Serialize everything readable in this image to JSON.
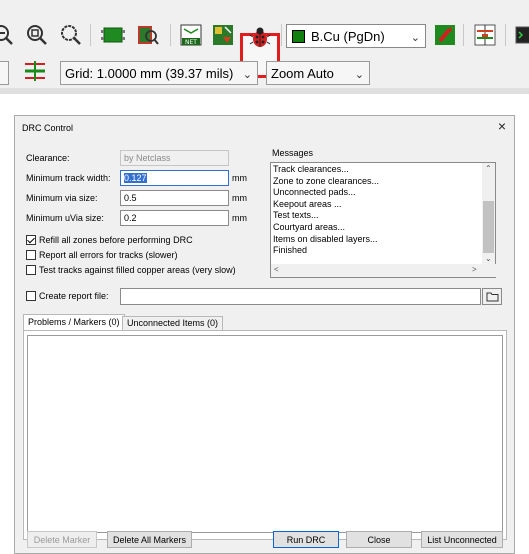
{
  "toolbar": {
    "icons": [
      "zoom-out-icon",
      "zoom-fit-icon",
      "zoom-selection-icon",
      "footprint-editor-icon",
      "footprint-browser-icon",
      "netlist-icon",
      "update-pcb-icon",
      "drc-ladybug-icon",
      "layer-pair-icon",
      "microwave-icon",
      "scripting-icon"
    ],
    "layer_select": "B.Cu (PgDn)",
    "layer_color": "#108010",
    "grid_select": "Grid: 1.0000 mm (39.37 mils)",
    "zoom_select": "Zoom Auto",
    "highlight_color": "#e21d1d"
  },
  "dialog": {
    "title": "DRC Control",
    "close": "×",
    "clearance_label": "Clearance:",
    "clearance_value": "by Netclass",
    "min_track_label": "Minimum track width:",
    "min_track_value": "0.127",
    "min_track_unit": "mm",
    "min_via_label": "Minimum via size:",
    "min_via_value": "0.5",
    "min_via_unit": "mm",
    "min_uvia_label": "Minimum uVia size:",
    "min_uvia_value": "0.2",
    "min_uvia_unit": "mm",
    "options": [
      {
        "label": "Refill all zones before performing DRC",
        "checked": true
      },
      {
        "label": "Report all errors for tracks (slower)",
        "checked": false
      },
      {
        "label": "Test tracks against filled copper areas (very slow)",
        "checked": false
      }
    ],
    "messages_label": "Messages",
    "messages": [
      "Track clearances...",
      "Zone to zone clearances...",
      "Unconnected pads...",
      "Keepout areas ...",
      "Test texts...",
      "Courtyard areas...",
      "Items on disabled layers...",
      "Finished"
    ],
    "create_report_label": "Create report file:",
    "create_report_value": "",
    "tabs": [
      "Problems / Markers (0)",
      "Unconnected Items (0)"
    ],
    "buttons": {
      "delete_marker": "Delete Marker",
      "delete_all": "Delete All Markers",
      "run_drc": "Run DRC",
      "close": "Close",
      "list_unconnected": "List Unconnected"
    }
  }
}
